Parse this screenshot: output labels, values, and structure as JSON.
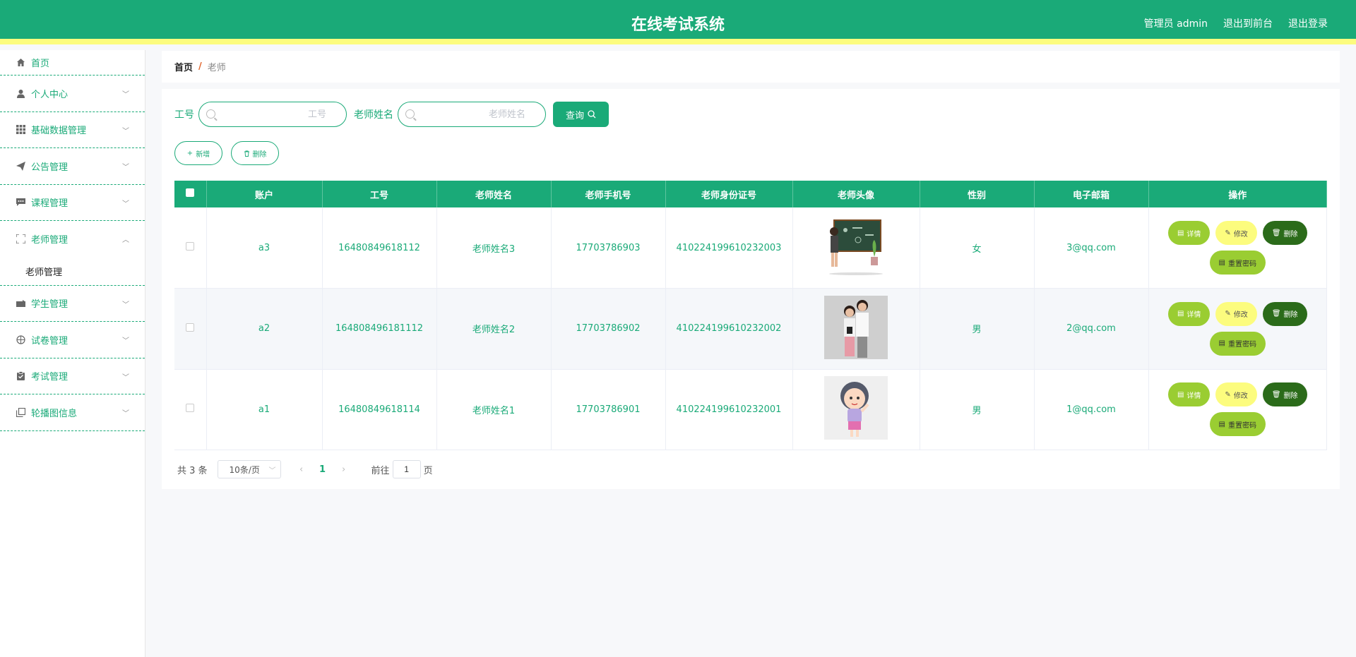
{
  "header": {
    "title": "在线考试系统",
    "admin_label": "管理员 admin",
    "exit_front": "退出到前台",
    "logout": "退出登录",
    "bg_color": "#1aaa78",
    "stripe_color": "#fcfc7e"
  },
  "sidebar": {
    "items": [
      {
        "label": "首页",
        "icon": "home-icon"
      },
      {
        "label": "个人中心",
        "icon": "user-icon"
      },
      {
        "label": "基础数据管理",
        "icon": "grid-icon"
      },
      {
        "label": "公告管理",
        "icon": "send-icon"
      },
      {
        "label": "课程管理",
        "icon": "chat-icon"
      },
      {
        "label": "老师管理",
        "icon": "fullscreen-icon"
      },
      {
        "label": "学生管理",
        "icon": "wallet-icon"
      },
      {
        "label": "试卷管理",
        "icon": "compass-icon"
      },
      {
        "label": "考试管理",
        "icon": "clipboard-icon"
      },
      {
        "label": "轮播图信息",
        "icon": "copy-icon"
      }
    ],
    "submenu": {
      "label": "老师管理"
    }
  },
  "breadcrumb": {
    "home": "首页",
    "separator": "/",
    "current": "老师"
  },
  "search": {
    "id_label": "工号",
    "id_placeholder": "工号",
    "name_label": "老师姓名",
    "name_placeholder": "老师姓名",
    "query_button": "查询"
  },
  "actions": {
    "add": "新增",
    "delete": "删除"
  },
  "table": {
    "headers": [
      "账户",
      "工号",
      "老师姓名",
      "老师手机号",
      "老师身份证号",
      "老师头像",
      "性别",
      "电子邮箱",
      "操作"
    ],
    "rows": [
      {
        "account": "a3",
        "id": "16480849618112",
        "name": "老师姓名3",
        "phone": "17703786903",
        "idcard": "410224199610232003",
        "avatar": "teacher-blackboard-image",
        "gender": "女",
        "email": "3@qq.com"
      },
      {
        "account": "a2",
        "id": "164808496181112",
        "name": "老师姓名2",
        "phone": "17703786902",
        "idcard": "410224199610232002",
        "avatar": "two-women-image",
        "gender": "男",
        "email": "2@qq.com"
      },
      {
        "account": "a1",
        "id": "16480849618114",
        "name": "老师姓名1",
        "phone": "17703786901",
        "idcard": "410224199610232001",
        "avatar": "cartoon-girl-image",
        "gender": "男",
        "email": "1@qq.com"
      }
    ],
    "op_labels": {
      "detail": "详情",
      "edit": "修改",
      "delete": "删除",
      "reset": "重置密码"
    }
  },
  "pager": {
    "total": "共 3 条",
    "page_size": "10条/页",
    "current_page": "1",
    "goto_label": "前往",
    "goto_value": "1",
    "page_suffix": "页"
  }
}
